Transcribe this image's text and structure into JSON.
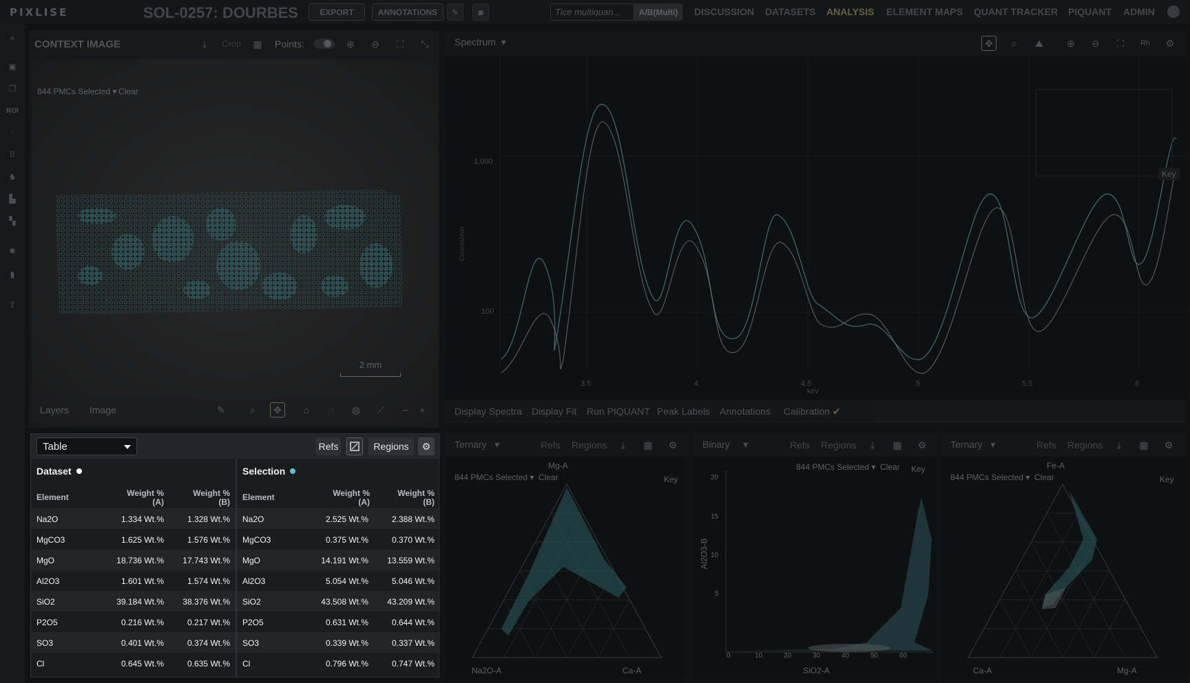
{
  "app": {
    "logo": "PIXLISE",
    "title": "SOL-0257: DOURBES"
  },
  "topbar": {
    "export_label": "EXPORT",
    "annotations_label": "ANNOTATIONS",
    "quant_placeholder": "Tice multiquan...",
    "ab_label": "A/B(Multi)",
    "nav": [
      "DISCUSSION",
      "DATASETS",
      "ANALYSIS",
      "ELEMENT MAPS",
      "QUANT TRACKER",
      "PIQUANT",
      "ADMIN"
    ],
    "active_nav": "ANALYSIS"
  },
  "rail": {
    "roi_label": "ROI"
  },
  "context": {
    "title": "CONTEXT IMAGE",
    "crop_label": "Crop",
    "points_label": "Points:",
    "selection_chip": "844 PMCs Selected ▾",
    "clear_label": "Clear",
    "scale_label": "2 mm",
    "footer": {
      "layers": "Layers",
      "image": "Image"
    }
  },
  "spectrum": {
    "select_label": "Spectrum",
    "ylabel": "Counts/min",
    "xlabel": "keV",
    "y_ticks": [
      "1,000",
      "100"
    ],
    "x_ticks": [
      "3.5",
      "4",
      "4.5",
      "5",
      "5.5",
      "6"
    ],
    "key_label": "Key",
    "footer": [
      "Display Spectra",
      "Display Fit",
      "Run PIQUANT",
      "Peak Labels",
      "Annotations",
      "Calibration"
    ]
  },
  "mini_charts": [
    {
      "type": "Ternary",
      "refs": "Refs",
      "regions": "Regions",
      "chip": "844 PMCs Selected ▾",
      "clear": "Clear",
      "key": "Key",
      "top": "Mg-A",
      "left": "Na2O-A",
      "right": "Ca-A"
    },
    {
      "type": "Binary",
      "refs": "Refs",
      "regions": "Regions",
      "chip": "844 PMCs Selected ▾",
      "clear": "Clear",
      "key": "Key",
      "ylabel": "Al2O3-B",
      "xlabel": "SiO2-A",
      "y_ticks": [
        "20",
        "15",
        "10",
        "5"
      ],
      "x_ticks": [
        "0",
        "10",
        "20",
        "30",
        "40",
        "50",
        "60"
      ]
    },
    {
      "type": "Ternary",
      "refs": "Refs",
      "regions": "Regions",
      "chip": "844 PMCs Selected ▾",
      "clear": "Clear",
      "key": "Key",
      "top": "Fe-A",
      "left": "Ca-A",
      "right": "Mg-A"
    }
  ],
  "table_panel": {
    "select_label": "Table",
    "refs_label": "Refs",
    "regions_label": "Regions",
    "colors": {
      "dataset_dot": "#ffffff",
      "selection_dot": "#5bc6d6"
    },
    "dataset": {
      "title": "Dataset",
      "headers": {
        "element": "Element",
        "wa": "Weight %\n(A)",
        "wb": "Weight %\n(B)"
      },
      "rows": [
        [
          "Na2O",
          "1.334 Wt.%",
          "1.328 Wt.%"
        ],
        [
          "MgCO3",
          "1.625 Wt.%",
          "1.576 Wt.%"
        ],
        [
          "MgO",
          "18.736 Wt.%",
          "17.743 Wt.%"
        ],
        [
          "Al2O3",
          "1.601 Wt.%",
          "1.574 Wt.%"
        ],
        [
          "SiO2",
          "39.184 Wt.%",
          "38.376 Wt.%"
        ],
        [
          "P2O5",
          "0.216 Wt.%",
          "0.217 Wt.%"
        ],
        [
          "SO3",
          "0.401 Wt.%",
          "0.374 Wt.%"
        ],
        [
          "Cl",
          "0.645 Wt.%",
          "0.635 Wt.%"
        ]
      ]
    },
    "selection": {
      "title": "Selection",
      "headers": {
        "element": "Element",
        "wa": "Weight %\n(A)",
        "wb": "Weight %\n(B)"
      },
      "rows": [
        [
          "Na2O",
          "2.525 Wt.%",
          "2.388 Wt.%"
        ],
        [
          "MgCO3",
          "0.375 Wt.%",
          "0.370 Wt.%"
        ],
        [
          "MgO",
          "14.191 Wt.%",
          "13.559 Wt.%"
        ],
        [
          "Al2O3",
          "5.054 Wt.%",
          "5.046 Wt.%"
        ],
        [
          "SiO2",
          "43.508 Wt.%",
          "43.209 Wt.%"
        ],
        [
          "P2O5",
          "0.631 Wt.%",
          "0.644 Wt.%"
        ],
        [
          "SO3",
          "0.339 Wt.%",
          "0.337 Wt.%"
        ],
        [
          "Cl",
          "0.796 Wt.%",
          "0.747 Wt.%"
        ]
      ]
    }
  }
}
